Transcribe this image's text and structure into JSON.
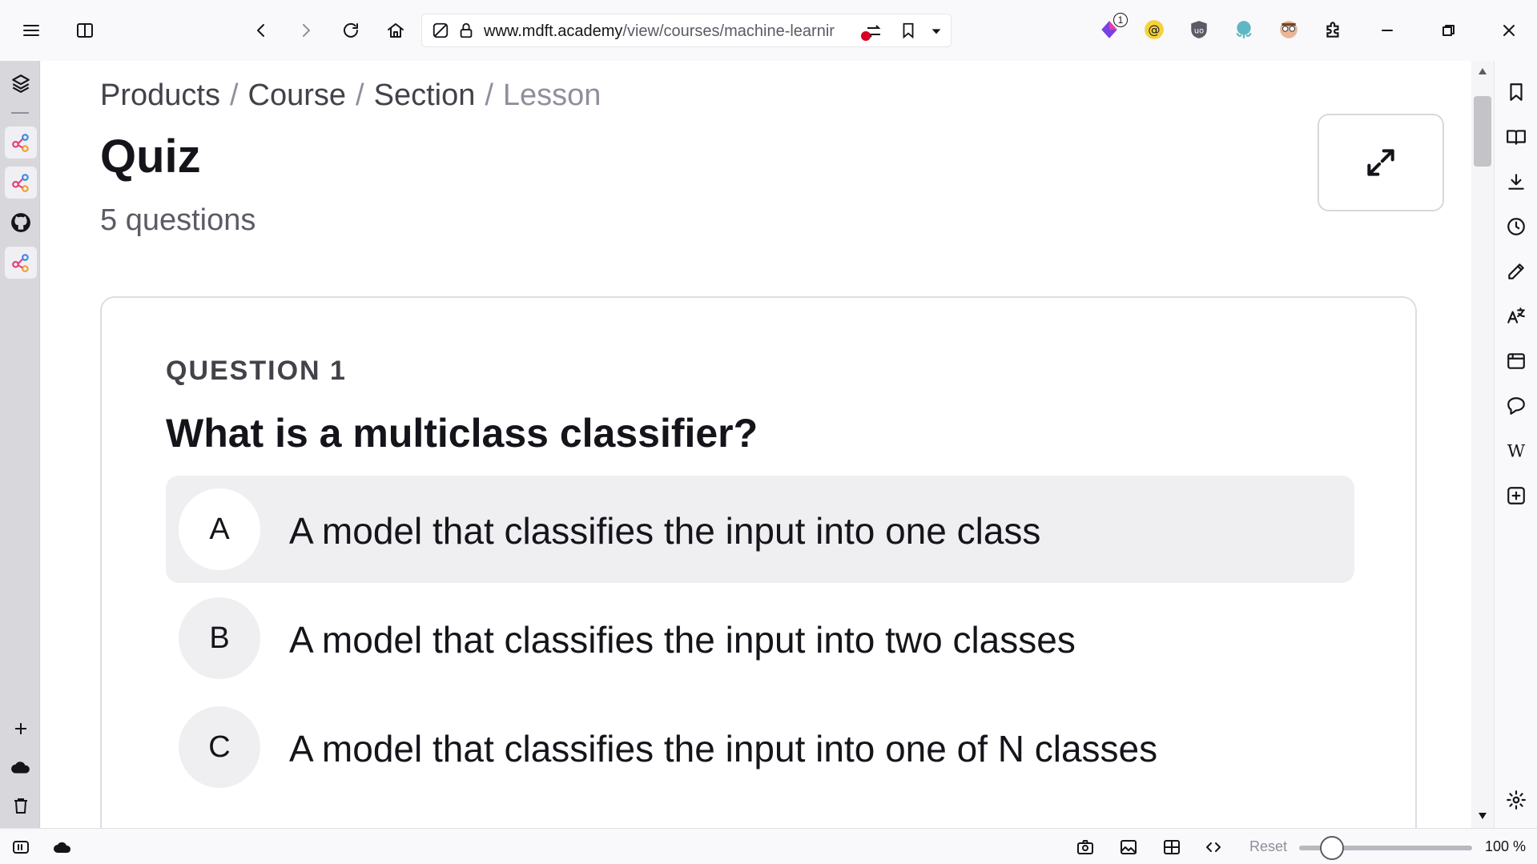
{
  "browser": {
    "url_host": "www.mdft.academy",
    "url_path": "/view/courses/machine-learnir",
    "extension_badge": "1"
  },
  "page": {
    "breadcrumb": [
      "Products",
      "Course",
      "Section",
      "Lesson"
    ],
    "breadcrumb_separator": "/",
    "title": "Quiz",
    "subtitle": "5 questions"
  },
  "quiz": {
    "question_label": "QUESTION 1",
    "question_text": "What is a multiclass classifier?",
    "options": [
      {
        "letter": "A",
        "text": "A model that classifies the input into one class"
      },
      {
        "letter": "B",
        "text": "A model that classifies the input into two classes"
      },
      {
        "letter": "C",
        "text": "A model that classifies the input into one of N classes"
      }
    ]
  },
  "statusbar": {
    "reset_label": "Reset",
    "zoom_label": "100 %"
  },
  "colors": {
    "accent": "#15141a",
    "option_hover": "#efeff1",
    "rail": "#d8d8dc"
  }
}
